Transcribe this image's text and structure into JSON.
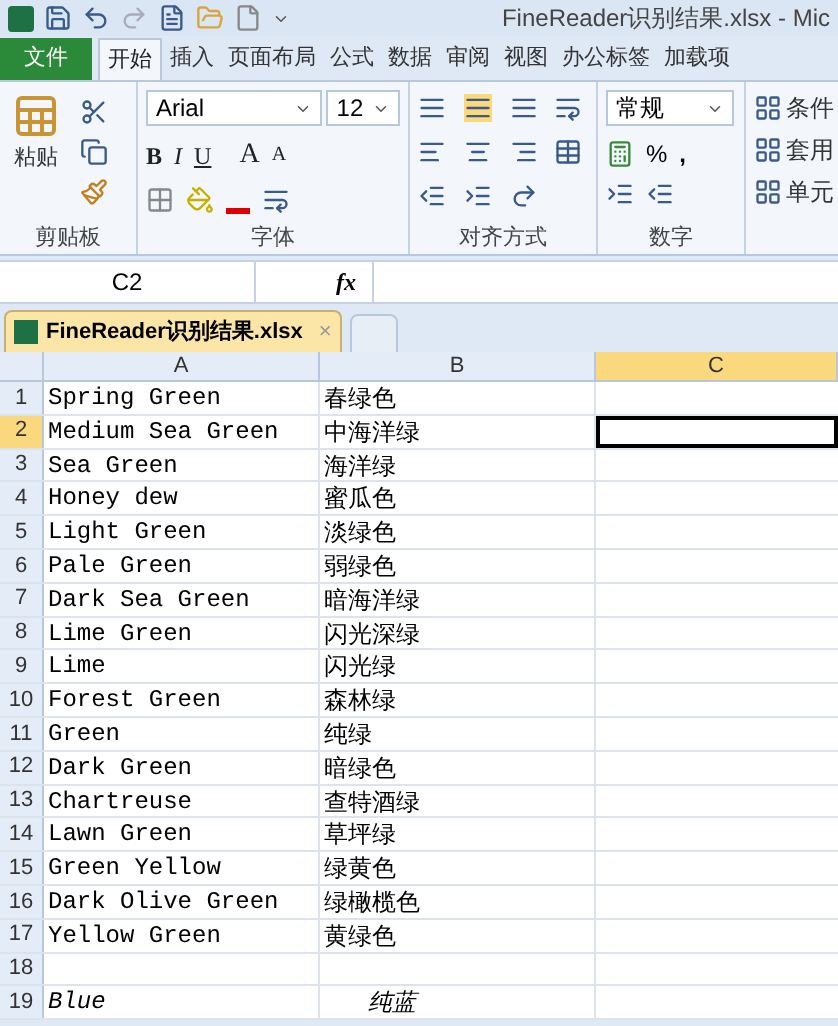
{
  "window": {
    "title": "FineReader识别结果.xlsx - Mic"
  },
  "tabs": [
    {
      "label": "文件",
      "kind": "file",
      "selected": false
    },
    {
      "label": "开始",
      "kind": "tab",
      "selected": true
    },
    {
      "label": "插入",
      "kind": "tab",
      "selected": false
    },
    {
      "label": "页面布局",
      "kind": "tab",
      "selected": false
    },
    {
      "label": "公式",
      "kind": "tab",
      "selected": false
    },
    {
      "label": "数据",
      "kind": "tab",
      "selected": false
    },
    {
      "label": "审阅",
      "kind": "tab",
      "selected": false
    },
    {
      "label": "视图",
      "kind": "tab",
      "selected": false
    },
    {
      "label": "办公标签",
      "kind": "tab",
      "selected": false
    },
    {
      "label": "加载项",
      "kind": "tab",
      "selected": false
    }
  ],
  "ribbon": {
    "paste_label": "粘贴",
    "font_name": "Arial",
    "font_size": "12",
    "bold": "B",
    "italic": "I",
    "underline": "U",
    "grow": "A",
    "shrink": "A",
    "number_format": "常规",
    "percent": "%",
    "comma": ",",
    "styles": [
      "条件",
      "套用",
      "单元"
    ],
    "groups": [
      "剪贴板",
      "字体",
      "对齐方式",
      "数字"
    ]
  },
  "formula_bar": {
    "name_box": "C2",
    "fx": "fx"
  },
  "workbook_tab": {
    "label": "FineReader识别结果.xlsx",
    "close": "×"
  },
  "columns": [
    {
      "label": "A",
      "selected": false
    },
    {
      "label": "B",
      "selected": false
    },
    {
      "label": "C",
      "selected": true
    }
  ],
  "rows": [
    {
      "number": "1",
      "a": "Spring Green",
      "b": "春绿色",
      "selected": false,
      "italic": false
    },
    {
      "number": "2",
      "a": "Medium Sea Green",
      "b": "中海洋绿",
      "selected": true,
      "italic": false
    },
    {
      "number": "3",
      "a": "Sea Green",
      "b": "海洋绿",
      "selected": false,
      "italic": false
    },
    {
      "number": "4",
      "a": "Honey dew",
      "b": "蜜瓜色",
      "selected": false,
      "italic": false
    },
    {
      "number": "5",
      "a": "Light Green",
      "b": "淡绿色",
      "selected": false,
      "italic": false
    },
    {
      "number": "6",
      "a": "Pale Green",
      "b": "弱绿色",
      "selected": false,
      "italic": false
    },
    {
      "number": "7",
      "a": "Dark Sea Green",
      "b": "暗海洋绿",
      "selected": false,
      "italic": false
    },
    {
      "number": "8",
      "a": "Lime Green",
      "b": "闪光深绿",
      "selected": false,
      "italic": false
    },
    {
      "number": "9",
      "a": "Lime",
      "b": "闪光绿",
      "selected": false,
      "italic": false
    },
    {
      "number": "10",
      "a": "Forest Green",
      "b": "森林绿",
      "selected": false,
      "italic": false
    },
    {
      "number": "11",
      "a": "Green",
      "b": "纯绿",
      "selected": false,
      "italic": false
    },
    {
      "number": "12",
      "a": "Dark Green",
      "b": "暗绿色",
      "selected": false,
      "italic": false
    },
    {
      "number": "13",
      "a": "Chartreuse",
      "b": "查特酒绿",
      "selected": false,
      "italic": false
    },
    {
      "number": "14",
      "a": "Lawn Green",
      "b": "草坪绿",
      "selected": false,
      "italic": false
    },
    {
      "number": "15",
      "a": "Green Yellow",
      "b": "绿黄色",
      "selected": false,
      "italic": false
    },
    {
      "number": "16",
      "a": "Dark Olive Green",
      "b": "绿橄榄色",
      "selected": false,
      "italic": false
    },
    {
      "number": "17",
      "a": "Yellow Green",
      "b": "黄绿色",
      "selected": false,
      "italic": false
    },
    {
      "number": "18",
      "selected": false
    },
    {
      "number": "19",
      "a": "Blue",
      "b": "纯蓝",
      "selected": false,
      "italic": true
    }
  ]
}
